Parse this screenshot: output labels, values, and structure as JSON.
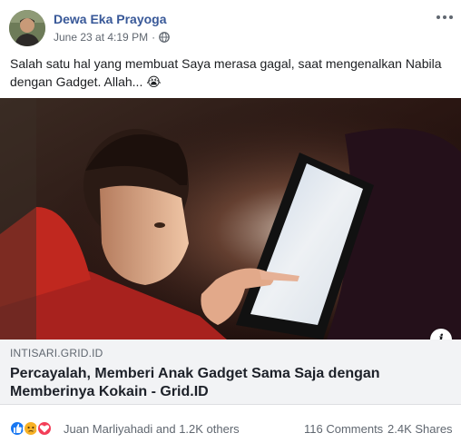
{
  "post": {
    "author": "Dewa Eka Prayoga",
    "timestamp": "June 23 at 4:19 PM",
    "separator": "·",
    "privacy_icon": "globe-icon",
    "more_icon": "more-options-icon",
    "text": "Salah satu hal yang membuat Saya merasa gagal, saat mengenalkan Nabila dengan Gadget. Allah... 😭"
  },
  "link_preview": {
    "image_description_icon": "child-using-tablet-photo",
    "info_label": "i",
    "domain": "INTISARI.GRID.ID",
    "title": "Percayalah, Memberi Anak Gadget Sama Saja dengan Memberinya Kokain - Grid.ID"
  },
  "stats": {
    "reaction_icons": [
      "like-icon",
      "sad-icon",
      "love-icon"
    ],
    "colors": {
      "like": "#1877f2",
      "sad": "#f7b125",
      "love": "#f33e58"
    },
    "reactors": "Juan Marliyahadi and 1.2K others",
    "comments": "116 Comments",
    "shares": "2.4K Shares"
  },
  "theme": {
    "link_color": "#385898",
    "secondary_text": "#606770",
    "link_box_bg": "#f2f3f5"
  }
}
